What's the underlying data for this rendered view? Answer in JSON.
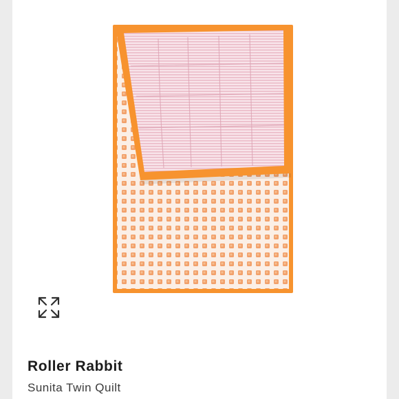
{
  "product": {
    "brand": "Roller Rabbit",
    "name": "Sunita Twin Quilt"
  },
  "icons": {
    "expand": "expand-arrows-icon"
  },
  "colors": {
    "quilt_border": "#f7932f",
    "quilt_pattern": "#f2a06a",
    "quilt_body": "#fbefe6",
    "quilt_pink": "#f4dbe2",
    "background": "#ececec",
    "card": "#ffffff"
  }
}
